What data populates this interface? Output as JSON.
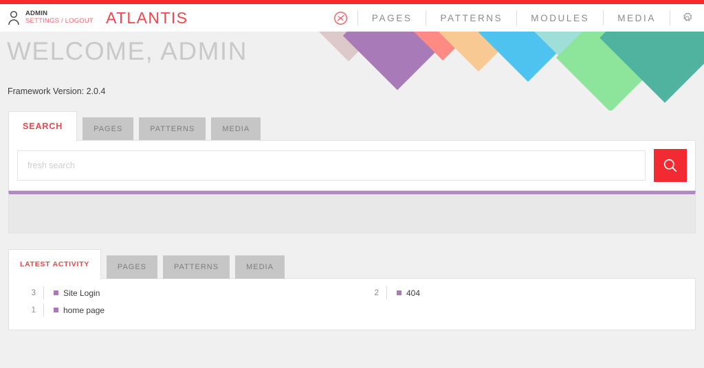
{
  "header": {
    "user_icon": "user-icon",
    "user_name": "ADMIN",
    "user_links": "SETTINGS / LOGOUT",
    "brand": "ATLANTIS",
    "dashboard_icon": "dashboard-gauge-icon",
    "settings_icon": "gear-icon",
    "nav": [
      {
        "label": "PAGES"
      },
      {
        "label": "PATTERNS"
      },
      {
        "label": "MODULES"
      },
      {
        "label": "MEDIA"
      }
    ]
  },
  "hero": {
    "welcome": "WELCOME, ADMIN",
    "version": "Framework Version: 2.0.4",
    "diamond_colors": [
      "#ddc9c9",
      "#a87bb8",
      "#fd8b83",
      "#f8c992",
      "#4fc3ef",
      "#9edfd9",
      "#8ce59a",
      "#4fb3a0"
    ]
  },
  "search": {
    "tabs": [
      {
        "label": "SEARCH",
        "active": true
      },
      {
        "label": "PAGES",
        "active": false
      },
      {
        "label": "PATTERNS",
        "active": false
      },
      {
        "label": "MEDIA",
        "active": false
      }
    ],
    "placeholder": "fresh search",
    "value": "",
    "button_icon": "magnifier-icon",
    "accent_color": "#f42a32",
    "results_bar_color": "#b488c4",
    "results": []
  },
  "activity": {
    "tabs": [
      {
        "label": "LATEST ACTIVITY",
        "active": true
      },
      {
        "label": "PAGES",
        "active": false
      },
      {
        "label": "PATTERNS",
        "active": false
      },
      {
        "label": "MEDIA",
        "active": false
      }
    ],
    "bullet_color": "#a87bb8",
    "left_column": [
      {
        "count": "3",
        "label": "Site Login"
      },
      {
        "count": "1",
        "label": "home page"
      }
    ],
    "right_column": [
      {
        "count": "2",
        "label": "404"
      }
    ]
  }
}
